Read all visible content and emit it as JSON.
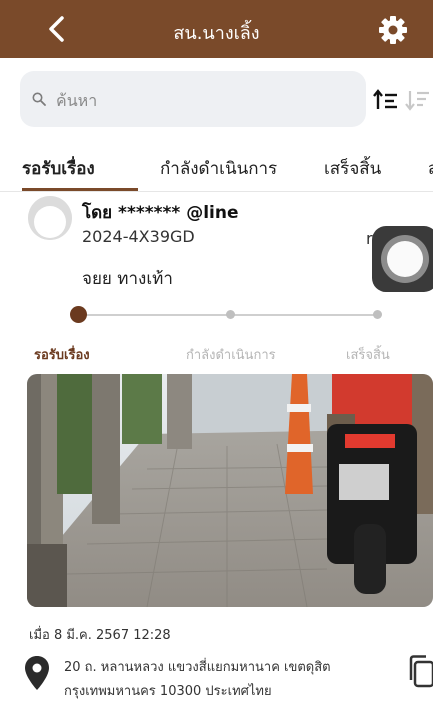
{
  "header": {
    "title": "สน.นางเลิ้ง",
    "back_icon": "chevron-left-icon",
    "settings_icon": "gear-icon",
    "background_color": "#7a4a2a"
  },
  "search": {
    "placeholder": "ค้นหา",
    "icon": "search-icon"
  },
  "tabs": [
    {
      "label": "รอรับเรื่อง",
      "active": true
    },
    {
      "label": "กำลังดำเนินการ",
      "active": false
    },
    {
      "label": "เสร็จสิ้น",
      "active": false
    },
    {
      "label": "ส",
      "active": false
    }
  ],
  "ticket": {
    "author": "โดย ******* @line",
    "id": "2024-4X39GD",
    "side_letter": "r",
    "subject": "จยย ทางเท้า",
    "progress": {
      "steps": [
        "รอรับเรื่อง",
        "กำลังดำเนินการ",
        "เสร็จสิ้น"
      ],
      "current_step": 1,
      "active_color": "#6b3a1f"
    },
    "timestamp": "เมื่อ 8 มี.ค. 2567 12:28",
    "address_line1": "20 ถ. หลานหลวง แขวงสี่แยกมหานาค เขตดุสิต",
    "address_line2": "กรุงเทพมหานคร 10300 ประเทศไทย"
  }
}
